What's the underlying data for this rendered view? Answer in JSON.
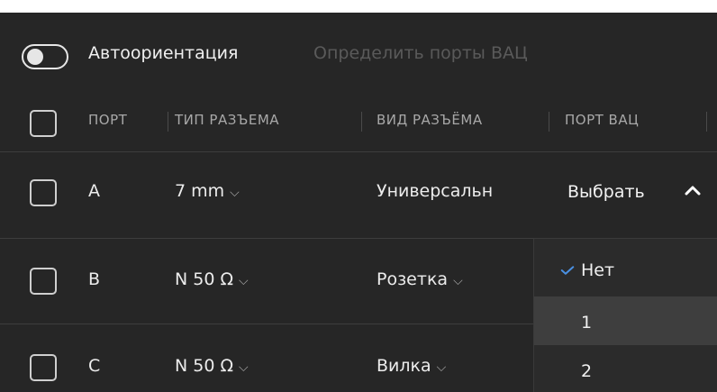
{
  "toolbar": {
    "toggle_state": "off",
    "auto_label": "Автоориентация",
    "detect_link": "Определить порты ВАЦ"
  },
  "table": {
    "headers": [
      "ПОРТ",
      "ТИП РАЗЪЕМА",
      "ВИД РАЗЪЁМА",
      "ПОРТ ВАЦ"
    ],
    "rows": [
      {
        "port": "A",
        "connector_type": "7 mm",
        "connector_kind": "Универсальн",
        "vna_port": "Выбрать"
      },
      {
        "port": "B",
        "connector_type": "N 50 Ω",
        "connector_kind": "Розетка",
        "vna_port": ""
      },
      {
        "port": "C",
        "connector_type": "N 50 Ω",
        "connector_kind": "Вилка",
        "vna_port": ""
      }
    ]
  },
  "dropdown": {
    "options": [
      "Нет",
      "1",
      "2"
    ],
    "selected": "Нет",
    "hovered": "1"
  },
  "icons": {
    "chevron_down": "chevron-down-icon",
    "chevron_up": "chevron-up-icon",
    "check": "check-icon"
  },
  "colors": {
    "background": "#262626",
    "accent_check": "#4a90e2",
    "muted_text": "#5a5a5a"
  }
}
